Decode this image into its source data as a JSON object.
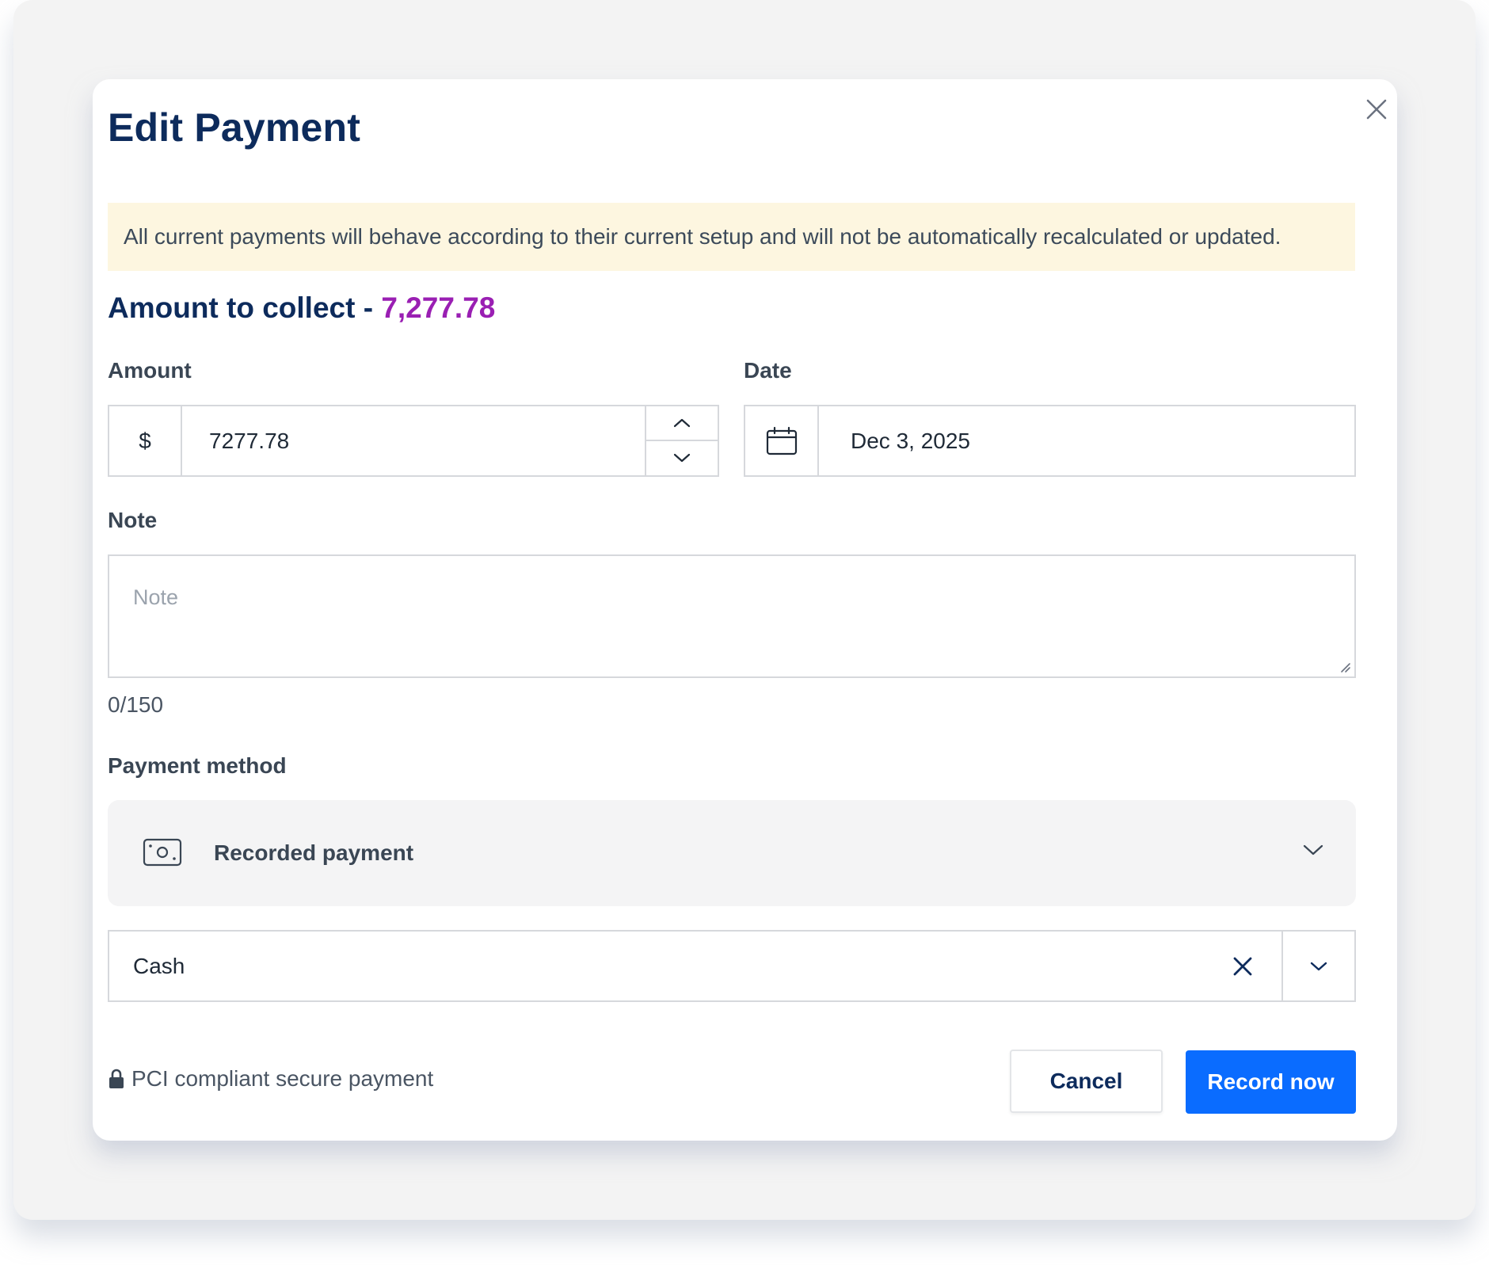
{
  "dialog": {
    "title": "Edit Payment",
    "close_icon": "close-icon",
    "banner_text": "All current payments will behave according to their current setup and will not be automatically recalculated or updated.",
    "collect_label": "Amount to collect - ",
    "collect_amount": "7,277.78"
  },
  "amount": {
    "label": "Amount",
    "prefix": "$",
    "value": "7277.78",
    "icons": [
      "chevron-up-icon",
      "chevron-down-icon"
    ]
  },
  "date": {
    "label": "Date",
    "value": "Dec 3, 2025",
    "icon": "calendar-icon"
  },
  "note": {
    "label": "Note",
    "placeholder": "Note",
    "value": "",
    "counter": "0/150"
  },
  "payment_method": {
    "label": "Payment method",
    "selected": "Recorded payment",
    "icon": "cash-icon",
    "sub_select": "Cash"
  },
  "footer": {
    "secure_text": "PCI compliant secure payment",
    "secure_icon": "lock-icon",
    "cancel_label": "Cancel",
    "record_label": "Record now"
  },
  "colors": {
    "title": "#0d2b5c",
    "amount_accent": "#9a1fb3",
    "banner_bg": "#fdf6e0",
    "primary_button": "#0a6cff"
  }
}
